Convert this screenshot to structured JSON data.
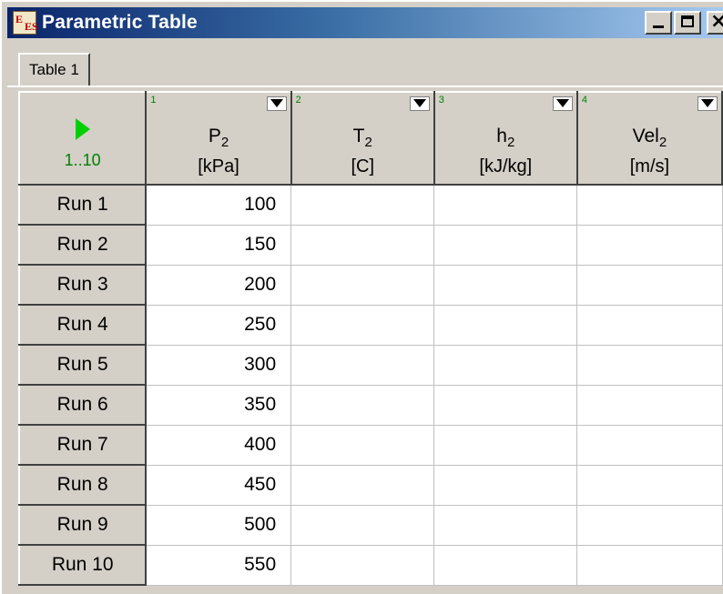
{
  "window": {
    "title": "Parametric Table",
    "icon_text_top": "E",
    "icon_text_bottom": "ES",
    "buttons": {
      "minimize": "_",
      "maximize": "□",
      "close": "×"
    }
  },
  "tabs": [
    {
      "label": "Table 1"
    }
  ],
  "corner": {
    "play_icon": "green-triangle",
    "range": "1..10"
  },
  "columns": [
    {
      "number": "1",
      "name": "P",
      "subscript": "2",
      "unit": "[kPa]"
    },
    {
      "number": "2",
      "name": "T",
      "subscript": "2",
      "unit": "[C]"
    },
    {
      "number": "3",
      "name": "h",
      "subscript": "2",
      "unit": "[kJ/kg]"
    },
    {
      "number": "4",
      "name": "Vel",
      "subscript": "2",
      "unit": "[m/s]"
    }
  ],
  "rows": [
    {
      "label": "Run 1",
      "values": [
        "100",
        "",
        "",
        ""
      ]
    },
    {
      "label": "Run 2",
      "values": [
        "150",
        "",
        "",
        ""
      ]
    },
    {
      "label": "Run 3",
      "values": [
        "200",
        "",
        "",
        ""
      ]
    },
    {
      "label": "Run 4",
      "values": [
        "250",
        "",
        "",
        ""
      ]
    },
    {
      "label": "Run 5",
      "values": [
        "300",
        "",
        "",
        ""
      ]
    },
    {
      "label": "Run 6",
      "values": [
        "350",
        "",
        "",
        ""
      ]
    },
    {
      "label": "Run 7",
      "values": [
        "400",
        "",
        "",
        ""
      ]
    },
    {
      "label": "Run 8",
      "values": [
        "450",
        "",
        "",
        ""
      ]
    },
    {
      "label": "Run 9",
      "values": [
        "500",
        "",
        "",
        ""
      ]
    },
    {
      "label": "Run 10",
      "values": [
        "550",
        "",
        "",
        ""
      ]
    }
  ],
  "colors": {
    "title_start": "#0a246a",
    "title_end": "#a6caf0",
    "accent_green": "#00d000",
    "column_number_green": "#008000",
    "face": "#d4d0c8"
  }
}
